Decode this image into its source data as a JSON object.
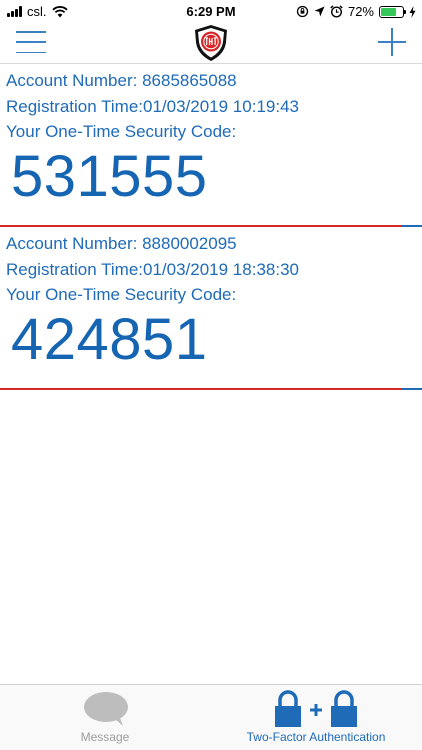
{
  "status_bar": {
    "carrier": "csl.",
    "time": "6:29 PM",
    "battery_percent": "72%",
    "battery_level": 0.72,
    "icons": [
      "signal-icon",
      "wifi-icon",
      "rotation-lock-icon",
      "location-icon",
      "alarm-icon",
      "battery-icon",
      "charging-icon"
    ]
  },
  "nav": {
    "menu_icon": "hamburger-menu-icon",
    "logo": "shield-logo",
    "add_icon": "plus-icon"
  },
  "accounts": [
    {
      "account_label": "Account Number:",
      "account_number": "8685865088",
      "registration_label": "Registration Time:",
      "registration_time": "01/03/2019 10:19:43",
      "code_label": "Your One-Time Security Code:",
      "code": "531555"
    },
    {
      "account_label": "Account Number:",
      "account_number": "8880002095",
      "registration_label": "Registration Time:",
      "registration_time": "01/03/2019 18:38:30",
      "code_label": "Your One-Time Security Code:",
      "code": "424851"
    }
  ],
  "tabs": [
    {
      "label": "Message",
      "icon": "chat-bubble-icon",
      "active": false
    },
    {
      "label": "Two-Factor Authentication",
      "icon": "lock-plus-lock-icon",
      "active": true
    }
  ],
  "colors": {
    "accent": "#1f6bb8",
    "divider_red": "#d62828",
    "inactive_tab": "#9e9e9e",
    "battery_green": "#34c759"
  }
}
